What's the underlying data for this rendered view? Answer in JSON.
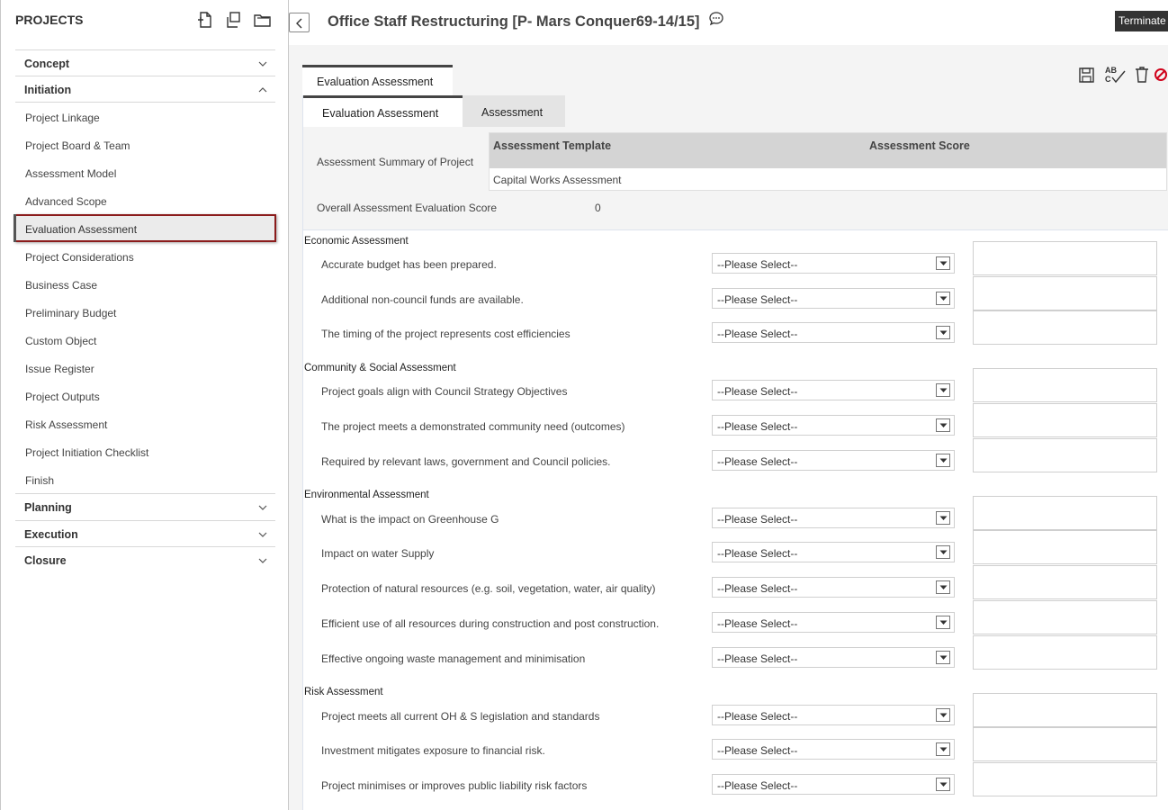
{
  "sidebar": {
    "title": "PROJECTS",
    "phases": {
      "concept": "Concept",
      "initiation": "Initiation",
      "planning": "Planning",
      "execution": "Execution",
      "closure": "Closure"
    },
    "steps": [
      "Project Linkage",
      "Project Board & Team",
      "Assessment Model",
      "Advanced Scope",
      "Evaluation Assessment",
      "Project Considerations",
      "Business Case",
      "Preliminary Budget",
      "Custom Object",
      "Issue Register",
      "Project Outputs",
      "Risk Assessment",
      "Project Initiation Checklist",
      "Finish"
    ],
    "active_step": "Evaluation Assessment"
  },
  "header": {
    "title": "Office Staff Restructuring [P- Mars Conquer69-14/15]",
    "terminate_label": "Terminate"
  },
  "tabs": {
    "outer": "Evaluation Assessment",
    "inner": [
      "Evaluation Assessment",
      "Assessment"
    ]
  },
  "summary": {
    "label": "Assessment Summary of Project",
    "col_template": "Assessment Template",
    "col_score": "Assessment Score",
    "template_value": "Capital Works Assessment",
    "score_value": "",
    "overall_label": "Overall Assessment Evaluation Score",
    "overall_value": "0"
  },
  "select_placeholder": "--Please Select--",
  "sections": {
    "economic": {
      "title": "Economic Assessment",
      "questions": [
        "Accurate budget has been prepared.",
        "Additional non-council funds are available.",
        "The timing of the project represents cost efficiencies"
      ]
    },
    "community": {
      "title": "Community & Social Assessment",
      "questions": [
        "Project goals align with Council Strategy Objectives",
        "The project meets a demonstrated community need (outcomes)",
        "Required by relevant laws, government and Council policies."
      ]
    },
    "environmental": {
      "title": "Environmental Assessment",
      "questions": [
        "What is the impact on Greenhouse G",
        "Impact on water Supply",
        "Protection of natural resources (e.g. soil, vegetation, water, air quality)",
        "Efficient use of all resources during construction and post construction.",
        "Effective ongoing waste management and minimisation"
      ]
    },
    "risk": {
      "title": "Risk Assessment",
      "questions": [
        "Project meets all current OH & S legislation and standards",
        "Investment mitigates exposure to financial risk.",
        "Project minimises or improves public liability risk factors"
      ]
    }
  },
  "colors": {
    "active_outline": "#8b1c1c",
    "terminate_bg": "#333333",
    "cancel_icon": "#d0021b"
  }
}
